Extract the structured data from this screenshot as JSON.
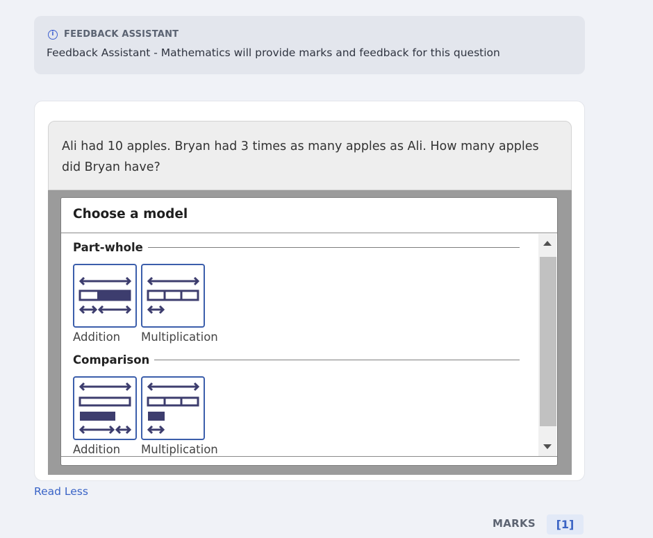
{
  "feedback_assistant": {
    "heading": "FEEDBACK ASSISTANT",
    "info_icon": "i",
    "message": "Feedback Assistant - Mathematics will provide marks and feedback for this question"
  },
  "question": {
    "text": "Ali had 10 apples. Bryan had 3 times as many apples as Ali. How many apples did Bryan have?"
  },
  "model_chooser": {
    "title": "Choose a model",
    "sections": [
      {
        "heading": "Part-whole",
        "models": [
          {
            "label": "Addition",
            "icon": "part-whole-addition-icon"
          },
          {
            "label": "Multiplication",
            "icon": "part-whole-multiplication-icon"
          }
        ]
      },
      {
        "heading": "Comparison",
        "models": [
          {
            "label": "Addition",
            "icon": "comparison-addition-icon"
          },
          {
            "label": "Multiplication",
            "icon": "comparison-multiplication-icon"
          }
        ]
      }
    ]
  },
  "read_less": "Read Less",
  "marks": {
    "label": "MARKS",
    "value": "[1]"
  },
  "colors": {
    "accent": "#3b5eab",
    "bar_fill": "#3d3d6e",
    "link": "#3963c6"
  }
}
